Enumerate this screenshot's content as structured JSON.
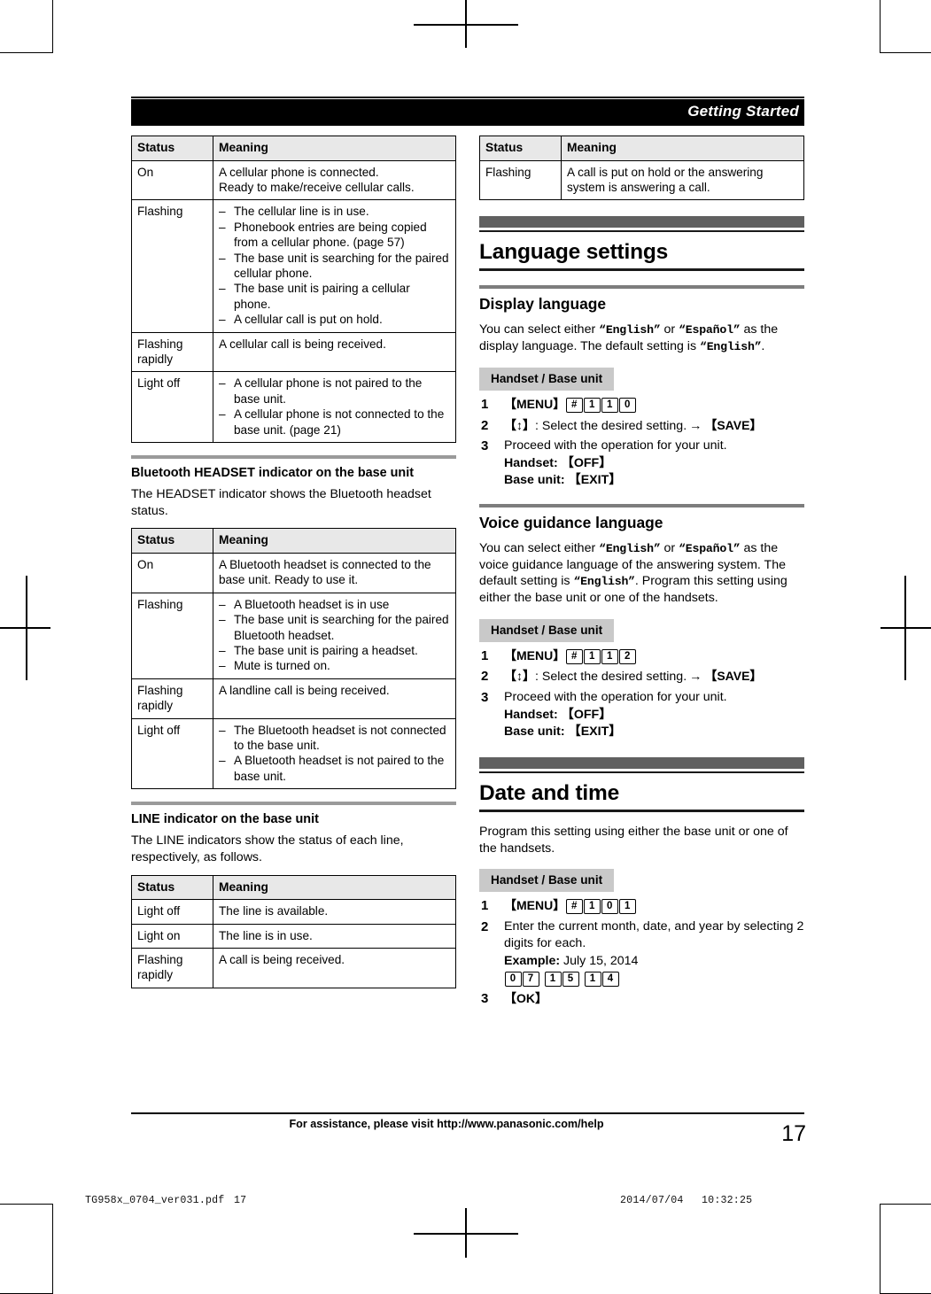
{
  "header": {
    "running_title": "Getting Started"
  },
  "left_column": {
    "cellular_table": {
      "headers": [
        "Status",
        "Meaning"
      ],
      "rows": [
        {
          "status": "On",
          "lines": [
            "A cellular phone is connected.",
            "Ready to make/receive cellular calls."
          ],
          "bulleted": false
        },
        {
          "status": "Flashing",
          "lines": [
            "The cellular line is in use.",
            "Phonebook entries are being copied from a cellular phone. (page 57)",
            "The base unit is searching for the paired cellular phone.",
            "The base unit is pairing a cellular phone.",
            "A cellular call is put on hold."
          ],
          "bulleted": true
        },
        {
          "status": "Flashing rapidly",
          "lines": [
            "A cellular call is being received."
          ],
          "bulleted": false
        },
        {
          "status": "Light off",
          "lines": [
            "A cellular phone is not paired to the base unit.",
            "A cellular phone is not connected to the base unit. (page 21)"
          ],
          "bulleted": true
        }
      ]
    },
    "headset_section": {
      "heading": "Bluetooth HEADSET indicator on the base unit",
      "intro": "The HEADSET indicator shows the Bluetooth headset status.",
      "table": {
        "headers": [
          "Status",
          "Meaning"
        ],
        "rows": [
          {
            "status": "On",
            "lines": [
              "A Bluetooth headset is connected to the base unit. Ready to use it."
            ],
            "bulleted": false
          },
          {
            "status": "Flashing",
            "lines": [
              "A Bluetooth headset is in use",
              "The base unit is searching for the paired Bluetooth headset.",
              "The base unit is pairing a headset.",
              "Mute is turned on."
            ],
            "bulleted": true
          },
          {
            "status": "Flashing rapidly",
            "lines": [
              "A landline call is being received."
            ],
            "bulleted": false
          },
          {
            "status": "Light off",
            "lines": [
              "The Bluetooth headset is not connected to the base unit.",
              "A Bluetooth headset is not paired to the base unit."
            ],
            "bulleted": true
          }
        ]
      }
    },
    "line_section": {
      "heading": "LINE indicator on the base unit",
      "intro": "The LINE indicators show the status of each line, respectively, as follows.",
      "table": {
        "headers": [
          "Status",
          "Meaning"
        ],
        "rows": [
          {
            "status": "Light off",
            "lines": [
              "The line is available."
            ],
            "bulleted": false
          },
          {
            "status": "Light on",
            "lines": [
              "The line is in use."
            ],
            "bulleted": false
          },
          {
            "status": "Flashing rapidly",
            "lines": [
              "A call is being received."
            ],
            "bulleted": false
          }
        ]
      }
    }
  },
  "right_column": {
    "hold_table": {
      "headers": [
        "Status",
        "Meaning"
      ],
      "rows": [
        {
          "status": "Flashing",
          "lines": [
            "A call is put on hold or the answering system is answering a call."
          ],
          "bulleted": false
        }
      ]
    },
    "language_settings": {
      "chapter_title": "Language settings",
      "display_language": {
        "heading": "Display language",
        "body_1": "You can select either ",
        "opt_1": "“English”",
        "body_2": " or ",
        "opt_2": "“Español”",
        "body_3": " as the display language. The default setting is ",
        "opt_3": "“English”",
        "body_4": ".",
        "unit_tag": "Handset / Base unit",
        "step1_key": "【MENU】",
        "step1_codes": [
          "#",
          "1",
          "1",
          "0"
        ],
        "step2_key": "【↕】",
        "step2_text": ": Select the desired setting.",
        "step2_arrow": "→",
        "step2_save": "【SAVE】",
        "step3_text": "Proceed with the operation for your unit.",
        "step3_handset": "Handset: 【OFF】",
        "step3_base": "Base unit: 【EXIT】"
      },
      "voice_guidance": {
        "heading": "Voice guidance language",
        "body_1": "You can select either ",
        "opt_1": "“English”",
        "body_2": " or ",
        "opt_2": "“Español”",
        "body_3": " as the voice guidance language of the answering system. The default setting is ",
        "opt_3": "“English”",
        "body_4": ". Program this setting using either the base unit or one of the handsets.",
        "unit_tag": "Handset / Base unit",
        "step1_key": "【MENU】",
        "step1_codes": [
          "#",
          "1",
          "1",
          "2"
        ],
        "step2_key": "【↕】",
        "step2_text": ": Select the desired setting.",
        "step2_arrow": "→",
        "step2_save": "【SAVE】",
        "step3_text": "Proceed with the operation for your unit.",
        "step3_handset": "Handset: 【OFF】",
        "step3_base": "Base unit: 【EXIT】"
      }
    },
    "date_and_time": {
      "chapter_title": "Date and time",
      "intro": "Program this setting using either the base unit or one of the handsets.",
      "unit_tag": "Handset / Base unit",
      "step1_key": "【MENU】",
      "step1_codes": [
        "#",
        "1",
        "0",
        "1"
      ],
      "step2_text": "Enter the current month, date, and year by selecting 2 digits for each.",
      "step2_example_label": "Example:",
      "step2_example_value": " July 15, 2014",
      "step2_codes": [
        "0",
        "7",
        "1",
        "5",
        "1",
        "4"
      ],
      "step3_key": "【OK】"
    }
  },
  "footer": {
    "assistance": "For assistance, please visit http://www.panasonic.com/help",
    "page_number": "17"
  },
  "print_slug": {
    "filename": "TG958x_0704_ver031.pdf",
    "page": "17",
    "date": "2014/07/04",
    "time": "10:32:25"
  }
}
